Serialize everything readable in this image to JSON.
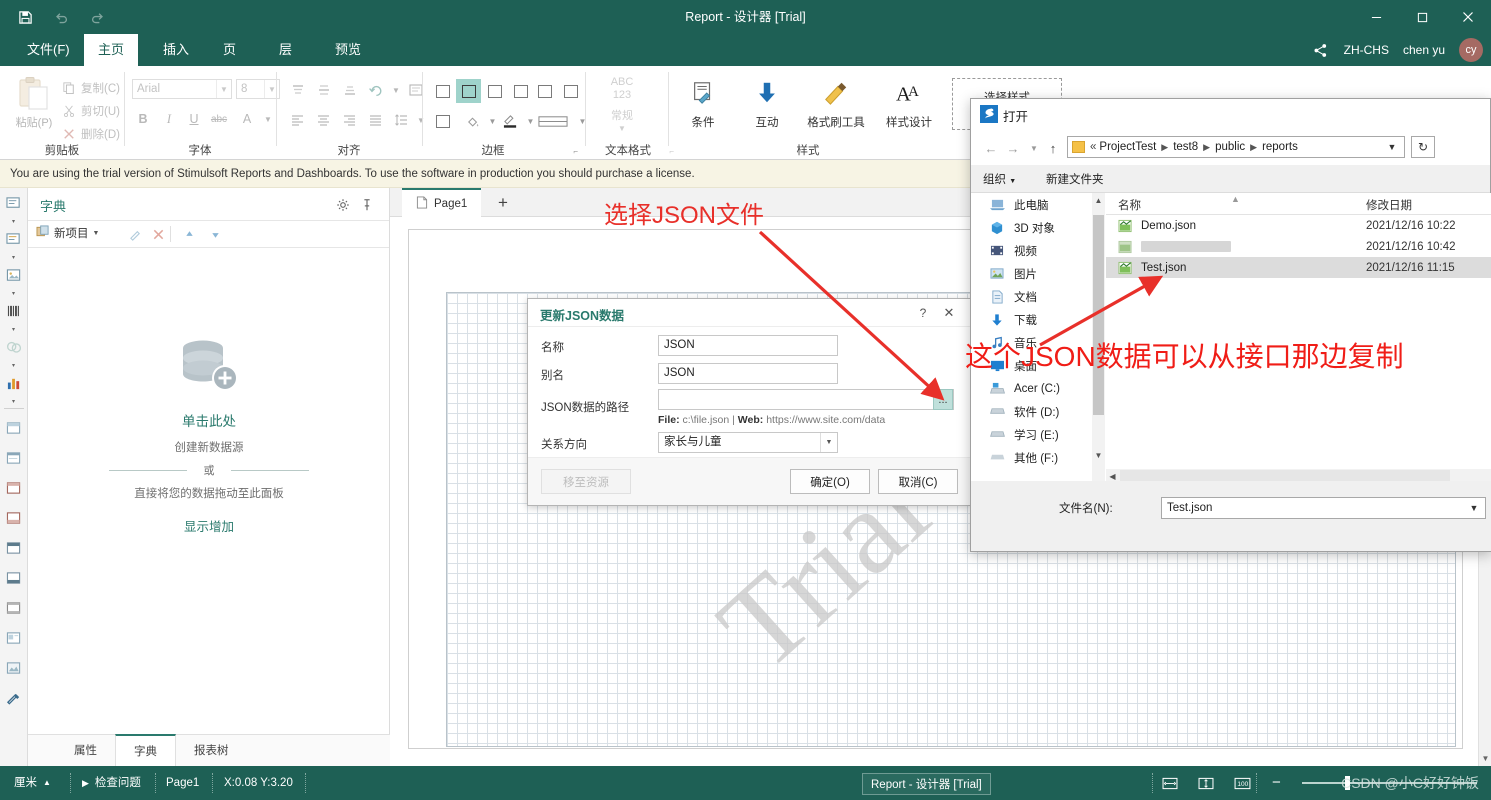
{
  "window": {
    "title": "Report - 设计器 [Trial]",
    "quick_access": [
      "save-icon",
      "undo-icon",
      "redo-icon"
    ],
    "controls": [
      "minimize",
      "maximize",
      "close"
    ],
    "accent": "#1e6055"
  },
  "ribbon": {
    "tabs": [
      {
        "label": "文件(F)",
        "active": false
      },
      {
        "label": "主页",
        "active": true
      },
      {
        "label": "插入",
        "active": false
      },
      {
        "label": "页",
        "active": false
      },
      {
        "label": "层",
        "active": false
      },
      {
        "label": "预览",
        "active": false
      }
    ],
    "right": {
      "share_icon": "share-icon",
      "language": "ZH-CHS",
      "user": "chen yu",
      "avatar_initials": "cy"
    },
    "groups": [
      {
        "name": "剪贴板",
        "paste_label": "粘贴(P)",
        "items": [
          {
            "label": "复制(C)",
            "icon": "copy-icon"
          },
          {
            "label": "剪切(U)",
            "icon": "cut-icon"
          },
          {
            "label": "删除(D)",
            "icon": "delete-icon"
          }
        ]
      },
      {
        "name": "字体",
        "font_family": "Arial",
        "font_size": "8",
        "buttons": [
          "bold",
          "italic",
          "underline",
          "strikethrough",
          "font-color"
        ]
      },
      {
        "name": "对齐",
        "buttons": [
          "align-top",
          "align-middle",
          "align-bottom",
          "rotate",
          "wrap-text",
          "align-left",
          "align-center",
          "align-right",
          "align-justify",
          "line-spacing"
        ]
      },
      {
        "name": "边框",
        "buttons": [
          "border-none",
          "border-all",
          "border-left",
          "border-right",
          "border-top",
          "border-bottom",
          "border-outline",
          "fill-color",
          "border-color",
          "border-style"
        ]
      },
      {
        "name": "文本格式",
        "sample_line1": "ABC",
        "sample_line2": "123",
        "sample_line3": "常规"
      },
      {
        "name": "样式",
        "buttons": [
          {
            "label": "条件",
            "icon": "condition-icon"
          },
          {
            "label": "互动",
            "icon": "interaction-icon"
          },
          {
            "label": "格式刷工具",
            "icon": "format-painter-icon"
          },
          {
            "label": "样式设计",
            "icon": "style-designer-icon"
          }
        ],
        "style_picker": "选择样式"
      }
    ]
  },
  "trial_banner": "You are using the trial version of Stimulsoft Reports and Dashboards. To use the software in production you should purchase a license.",
  "dictionary_panel": {
    "title": "字典",
    "gear_icon": "gear-icon",
    "pin_icon": "pin-icon",
    "toolbar": {
      "new_item": "新项目",
      "buttons": [
        "edit-icon",
        "delete-icon",
        "move-up-icon",
        "move-down-icon"
      ]
    },
    "empty_state": {
      "icon": "database-add-icon",
      "primary": "单击此处",
      "secondary": "创建新数据源",
      "or": "或",
      "tertiary": "直接将您的数据拖动至此面板",
      "link": "显示增加"
    },
    "tabs": [
      {
        "label": "属性",
        "active": false
      },
      {
        "label": "字典",
        "active": true
      },
      {
        "label": "报表树",
        "active": false
      }
    ]
  },
  "left_strip_icons": [
    "text-box-icon",
    "rich-text-icon",
    "image-icon",
    "barcode-icon",
    "shape-icon",
    "chart-icon",
    "report-title-band-icon",
    "page-header-band-icon",
    "header-band-icon",
    "data-band-icon",
    "footer-band-icon",
    "page-footer-band-icon",
    "group-header-band-icon",
    "group-footer-band-icon",
    "panel-icon",
    "tools-icon"
  ],
  "designer": {
    "page_tab": "Page1",
    "page_tab_icon": "page-icon",
    "add_page_button": "+",
    "watermark": "Trial"
  },
  "json_dialog": {
    "title": "更新JSON数据",
    "help_icon": "help-icon",
    "close_icon": "close-icon",
    "fields": [
      {
        "label": "名称",
        "value": "JSON"
      },
      {
        "label": "别名",
        "value": "JSON"
      }
    ],
    "path_label": "JSON数据的路径",
    "path_value": "",
    "path_placeholder": "",
    "browse_button": "...",
    "hint_file_key": "File:",
    "hint_file_val": "c:\\file.json",
    "hint_sep": "|",
    "hint_web_key": "Web:",
    "hint_web_val": "https://www.site.com/data",
    "relation_label": "关系方向",
    "relation_value": "家长与儿童",
    "move_button": "移至资源",
    "ok_button": "确定(O)",
    "cancel_button": "取消(C)"
  },
  "open_dialog": {
    "title": "打开",
    "logo_icon": "stimulsoft-logo-icon",
    "nav": {
      "back_icon": "back-arrow-icon",
      "forward_icon": "forward-arrow-icon",
      "recent_icon": "recent-dropdown-icon",
      "up_icon": "up-arrow-icon",
      "refresh_icon": "refresh-icon",
      "breadcrumb_overflow": "«",
      "breadcrumb": [
        "ProjectTest",
        "test8",
        "public",
        "reports"
      ],
      "crumb_dropdown_icon": "chevron-down-icon"
    },
    "toolbar": [
      {
        "label": "组织",
        "has_dropdown": true
      },
      {
        "label": "新建文件夹",
        "has_dropdown": false
      }
    ],
    "sidebar": [
      {
        "label": "此电脑",
        "icon": "this-pc-icon"
      },
      {
        "label": "3D 对象",
        "icon": "3d-objects-icon"
      },
      {
        "label": "视频",
        "icon": "videos-icon"
      },
      {
        "label": "图片",
        "icon": "pictures-icon"
      },
      {
        "label": "文档",
        "icon": "documents-icon"
      },
      {
        "label": "下载",
        "icon": "downloads-icon"
      },
      {
        "label": "音乐",
        "icon": "music-icon"
      },
      {
        "label": "桌面",
        "icon": "desktop-icon"
      },
      {
        "label": "Acer (C:)",
        "icon": "system-drive-icon"
      },
      {
        "label": "软件 (D:)",
        "icon": "drive-icon"
      },
      {
        "label": "学习 (E:)",
        "icon": "drive-icon"
      },
      {
        "label": "其他 (F:)",
        "icon": "drive-icon"
      }
    ],
    "columns": [
      {
        "label": "名称"
      },
      {
        "label": "修改日期"
      }
    ],
    "files": [
      {
        "name": "Demo.json",
        "date": "2021/12/16 10:22",
        "selected": false,
        "blurred": false,
        "icon": "json-file-icon"
      },
      {
        "name": "",
        "date": "2021/12/16 10:42",
        "selected": false,
        "blurred": true,
        "icon": "json-file-icon"
      },
      {
        "name": "Test.json",
        "date": "2021/12/16 11:15",
        "selected": true,
        "blurred": false,
        "icon": "json-file-icon"
      }
    ],
    "filename_label": "文件名(N):",
    "filename_value": "Test.json"
  },
  "annotations": [
    {
      "text": "选择JSON文件",
      "color": "#e8302a"
    },
    {
      "text": "这个JSON数据可以从接口那边复制",
      "color": "#f01d17"
    }
  ],
  "statusbar": {
    "units": "厘米",
    "units_dropdown_icon": "chevron-up-icon",
    "check_issues": "检查问题",
    "check_issues_icon": "play-icon",
    "page": "Page1",
    "coords": "X:0.08 Y:3.20",
    "view_icons": [
      "page-view-icon",
      "fit-width-icon",
      "zoom-100-icon"
    ],
    "zoom_minus": "−",
    "watermark": "CSDN @小C好好钟饭"
  },
  "taskbar_tooltip": "Report - 设计器 [Trial]"
}
